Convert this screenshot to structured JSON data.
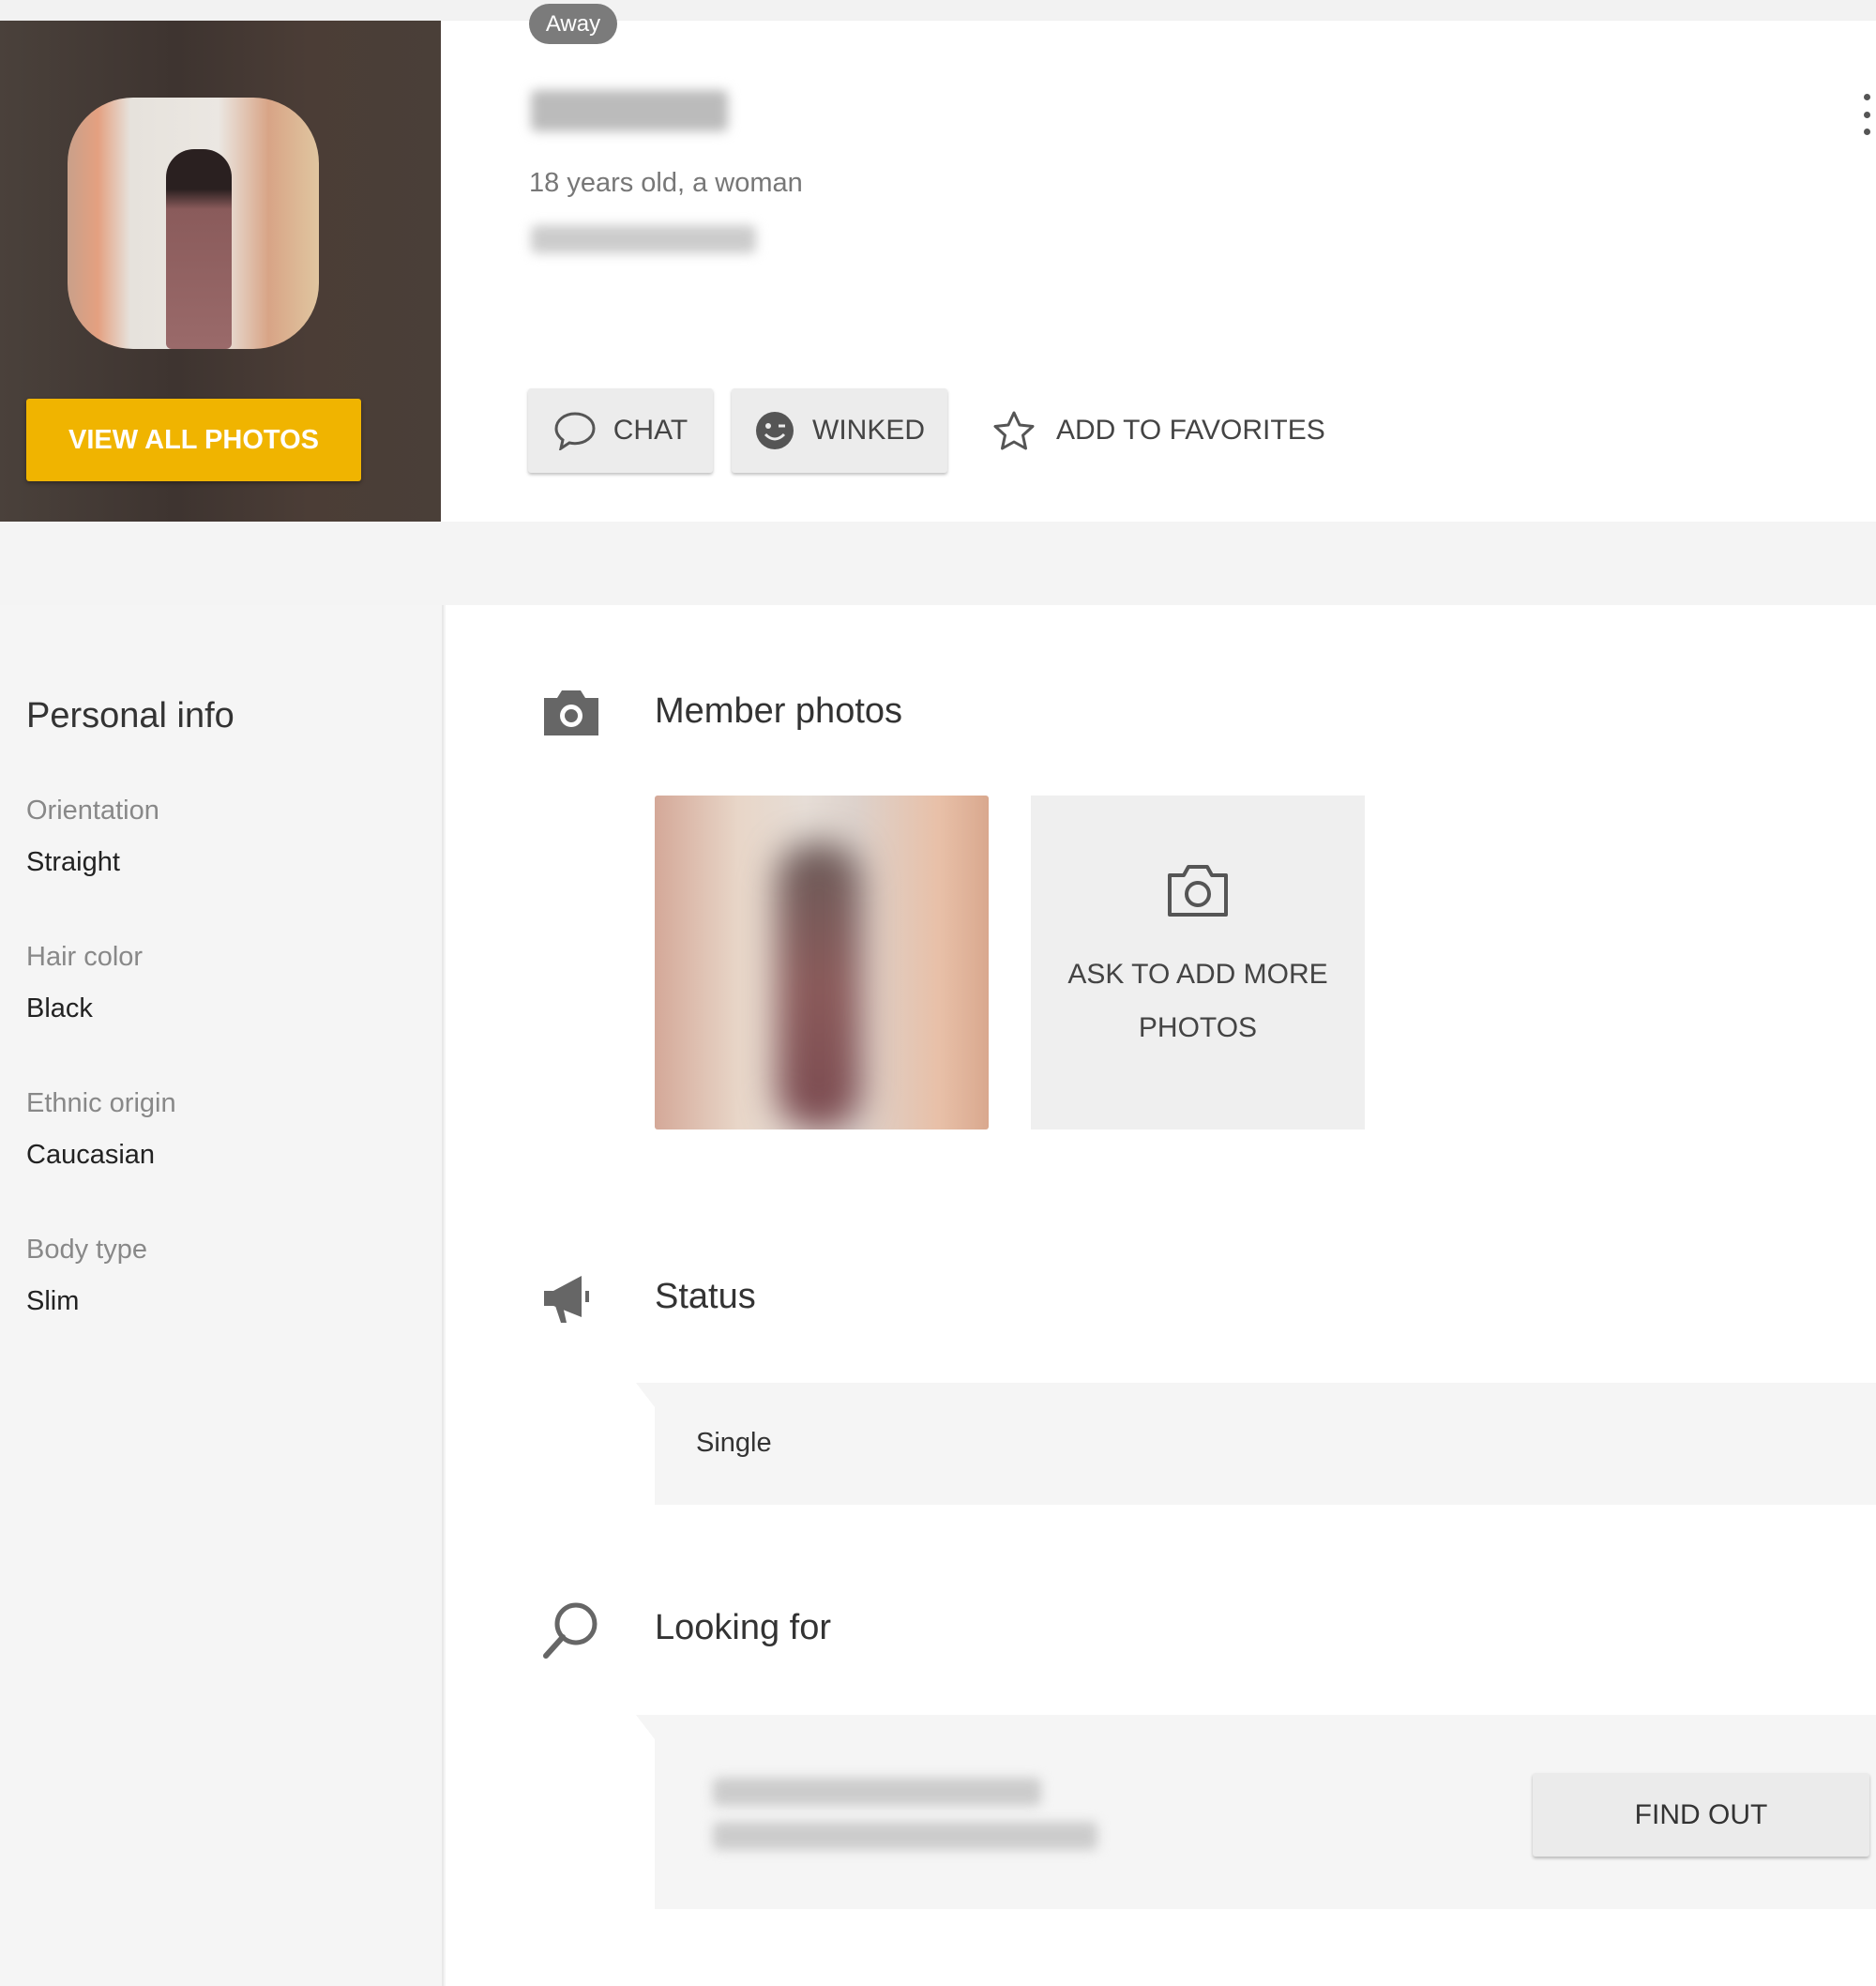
{
  "header": {
    "status_badge": "Away",
    "age_gender": "18 years old, a woman",
    "view_all_photos": "VIEW ALL PHOTOS",
    "chat_label": "CHAT",
    "winked_label": "WINKED",
    "favorites_label": "ADD TO FAVORITES",
    "accent_color": "#f0b400"
  },
  "sidebar": {
    "title": "Personal info",
    "items": [
      {
        "label": "Orientation",
        "value": "Straight"
      },
      {
        "label": "Hair color",
        "value": "Black"
      },
      {
        "label": "Ethnic origin",
        "value": "Caucasian"
      },
      {
        "label": "Body type",
        "value": "Slim"
      }
    ]
  },
  "main": {
    "photos": {
      "title": "Member photos",
      "icon": "camera-icon",
      "ask_more": "ASK TO ADD MORE PHOTOS"
    },
    "status": {
      "title": "Status",
      "icon": "megaphone-icon",
      "value": "Single"
    },
    "looking_for": {
      "title": "Looking for",
      "icon": "search-icon",
      "button": "FIND OUT"
    }
  }
}
